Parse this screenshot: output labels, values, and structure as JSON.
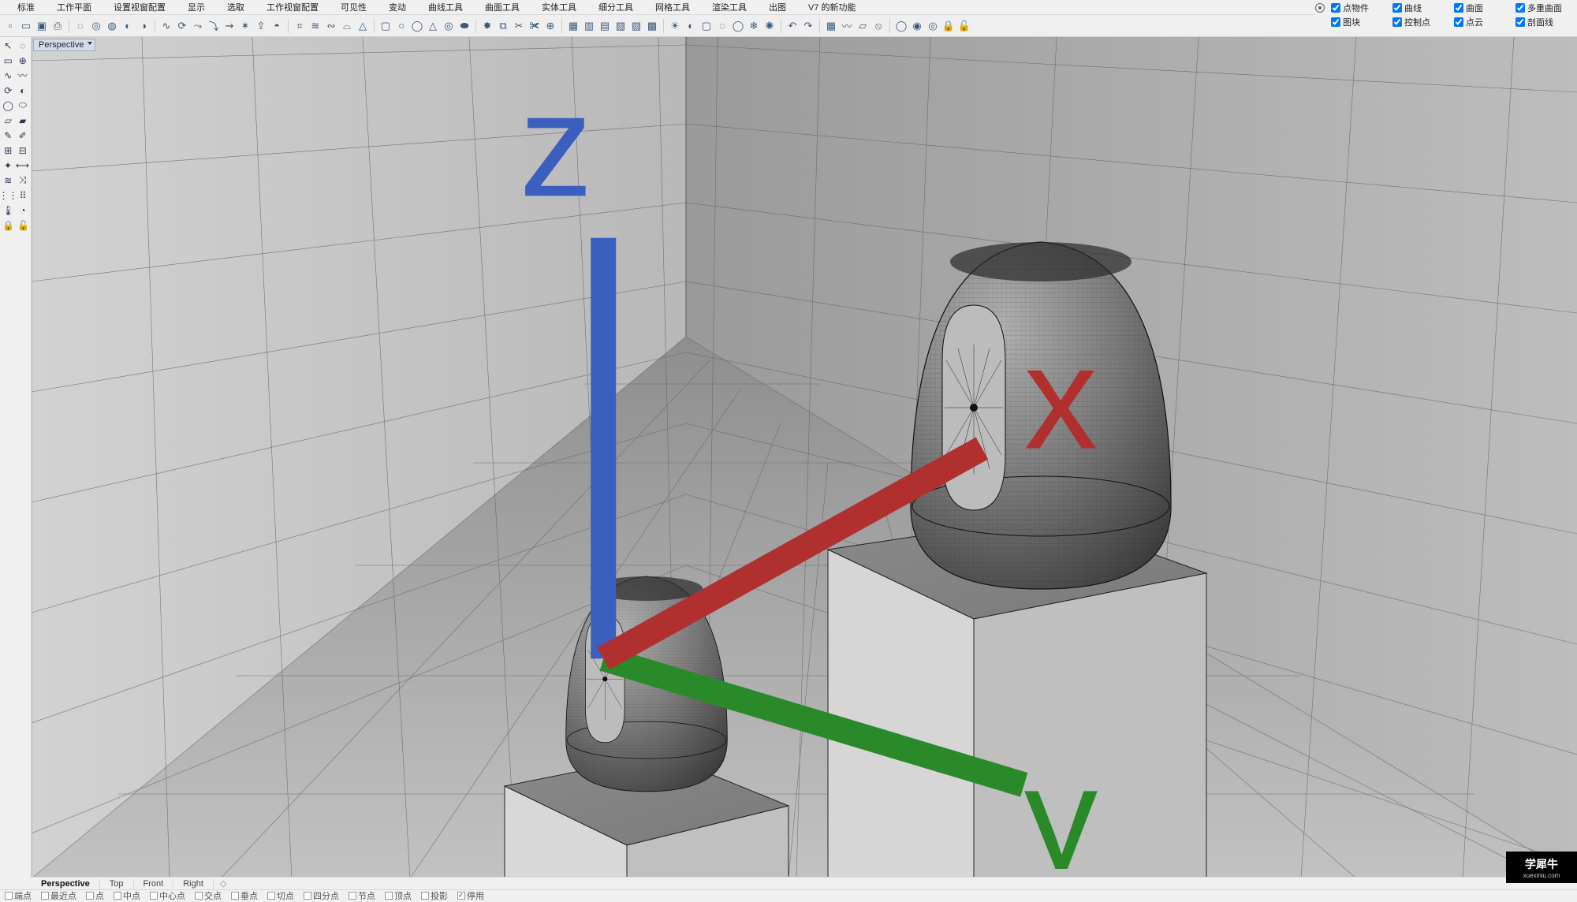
{
  "menu": {
    "items": [
      "标准",
      "工作平面",
      "设置视窗配置",
      "显示",
      "选取",
      "工作视窗配置",
      "可见性",
      "变动",
      "曲线工具",
      "曲面工具",
      "实体工具",
      "细分工具",
      "网格工具",
      "渲染工具",
      "出图",
      "V7 的新功能"
    ]
  },
  "filters": {
    "cols": [
      {
        "items": [
          {
            "label": "点物件",
            "checked": true
          },
          {
            "label": "图块",
            "checked": true
          }
        ]
      },
      {
        "items": [
          {
            "label": "曲线",
            "checked": true
          },
          {
            "label": "控制点",
            "checked": true
          }
        ]
      },
      {
        "items": [
          {
            "label": "曲面",
            "checked": true
          },
          {
            "label": "点云",
            "checked": true
          }
        ]
      },
      {
        "items": [
          {
            "label": "多重曲面",
            "checked": true
          },
          {
            "label": "剖面线",
            "checked": true
          }
        ]
      }
    ]
  },
  "viewport": {
    "title": "Perspective"
  },
  "viewtabs": {
    "items": [
      "Perspective",
      "Top",
      "Front",
      "Right"
    ],
    "active": 0
  },
  "snaps": {
    "items": [
      {
        "label": "端点",
        "on": false
      },
      {
        "label": "最近点",
        "on": false
      },
      {
        "label": "点",
        "on": false
      },
      {
        "label": "中点",
        "on": false
      },
      {
        "label": "中心点",
        "on": false
      },
      {
        "label": "交点",
        "on": false
      },
      {
        "label": "垂点",
        "on": false
      },
      {
        "label": "切点",
        "on": false
      },
      {
        "label": "四分点",
        "on": false
      },
      {
        "label": "节点",
        "on": false
      },
      {
        "label": "顶点",
        "on": false
      },
      {
        "label": "投影",
        "on": false
      },
      {
        "label": "停用",
        "on": true
      }
    ]
  },
  "toolbar_top": {
    "icons": [
      "new",
      "open",
      "save",
      "print",
      "sep",
      "cplane-o",
      "cplane-x",
      "cplane-w",
      "cplane-3",
      "cplane-p",
      "sep",
      "loft",
      "revolve",
      "sweep1",
      "sweep2",
      "rail",
      "network",
      "extrude",
      "cap",
      "sep",
      "cage",
      "flow",
      "twist",
      "bend",
      "taper",
      "sep",
      "box",
      "sphere",
      "cyl",
      "cone",
      "torus",
      "pipe",
      "sep",
      "explode",
      "join",
      "split",
      "trim",
      "boolean",
      "sep",
      "mesh1",
      "mesh2",
      "mesh3",
      "mesh4",
      "mesh5",
      "mesh6",
      "sep",
      "render",
      "shade",
      "wire",
      "xray",
      "ghost",
      "arctic",
      "raytrace",
      "sep",
      "undo",
      "redo",
      "sep",
      "dmesh",
      "dcurve",
      "dpoly",
      "dnone",
      "sep",
      "hide",
      "show",
      "iso",
      "lock",
      "unlock"
    ]
  },
  "side_toolbar": {
    "rows": [
      [
        "pointer",
        "lasso"
      ],
      [
        "box-sel",
        "bool"
      ],
      [
        "curve1",
        "curve2"
      ],
      [
        "revolve",
        "lathe"
      ],
      [
        "ellipse",
        "pill"
      ],
      [
        "surf1",
        "surf2"
      ],
      [
        "edit1",
        "edit2"
      ],
      [
        "boolA",
        "boolB"
      ],
      [
        "analyze",
        "dim"
      ],
      [
        "flow",
        "morph"
      ],
      [
        "array",
        "dots"
      ],
      [
        "temp",
        "gauge"
      ],
      [
        "lock",
        "unlock"
      ]
    ]
  },
  "watermark": {
    "title": "学犀牛",
    "sub": "xuexiniu.com"
  }
}
